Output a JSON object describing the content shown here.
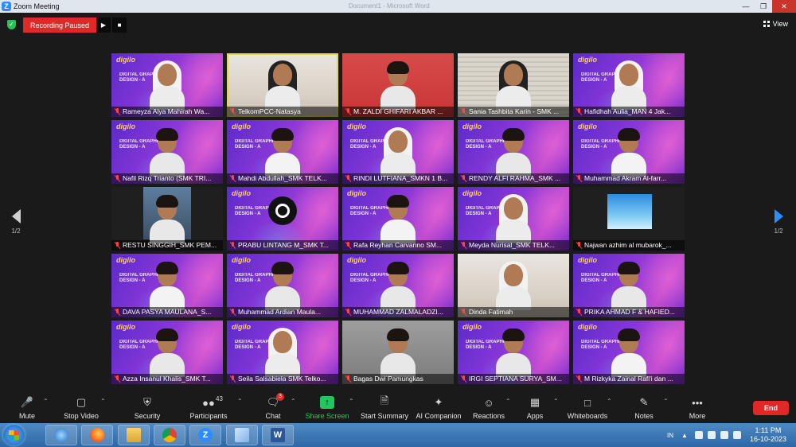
{
  "window": {
    "title": "Zoom Meeting",
    "ghost_title": "Document1 - Microsoft Word"
  },
  "topbar": {
    "recording_label": "Recording Paused",
    "view_label": "View"
  },
  "paging": {
    "left": "1/2",
    "right": "1/2"
  },
  "participants": [
    {
      "name": "Rameyza Alya Mahirah Wa...",
      "bg": "banner"
    },
    {
      "name": "TelkomPCC-Natasya",
      "bg": "room",
      "active": true
    },
    {
      "name": "M. ZALDI GHIFARI AKBAR ...",
      "bg": "red"
    },
    {
      "name": "Sania Tashbita Karin - SMK ...",
      "bg": "blinds"
    },
    {
      "name": "Hafidhah Aulia_MAN 4 Jak...",
      "bg": "banner"
    },
    {
      "name": "Nafil Rizq Trianto (SMK TRI...",
      "bg": "banner"
    },
    {
      "name": "Mahdi Abdullah_SMK TELK...",
      "bg": "banner"
    },
    {
      "name": "RINDI LUTFIANA_SMKN 1 B...",
      "bg": "banner"
    },
    {
      "name": "RENDY ALFI RAHMA_SMK ...",
      "bg": "banner"
    },
    {
      "name": "Muhammad Akram Al-farr...",
      "bg": "banner"
    },
    {
      "name": "RESTU SINGGIH_SMK PEM...",
      "bg": "inset"
    },
    {
      "name": "PRABU LINTANG M_SMK T...",
      "bg": "obs"
    },
    {
      "name": "Rafa Reyhan Carvanno SM...",
      "bg": "banner"
    },
    {
      "name": "Meyda Nurisal_SMK TELK...",
      "bg": "banner"
    },
    {
      "name": "Najwan azhim al mubarok_...",
      "bg": "sky"
    },
    {
      "name": "DAVA PASYA MAULANA_S...",
      "bg": "banner"
    },
    {
      "name": "Muhammad Ardian Maula...",
      "bg": "banner"
    },
    {
      "name": "MUHAMMAD ZALMALADZI...",
      "bg": "banner"
    },
    {
      "name": "Dinda Fatimah",
      "bg": "room"
    },
    {
      "name": "PRIKA AHMAD F & HAFIED...",
      "bg": "banner"
    },
    {
      "name": "Azza Insanul Khalis_SMK T...",
      "bg": "banner"
    },
    {
      "name": "Seila Salsabiela SMK Telko...",
      "bg": "banner"
    },
    {
      "name": "Bagas Dwi Pamungkas",
      "bg": "wall"
    },
    {
      "name": "IRGI SEPTIANA SURYA_SM...",
      "bg": "banner"
    },
    {
      "name": "M Rizkyka Zainal Rafi'i dan ...",
      "bg": "banner"
    }
  ],
  "banner": {
    "logo": "digilo",
    "title_line1": "DIGITAL GRAPHIC",
    "title_line2": "DESIGN - A"
  },
  "toolbar": {
    "mute": "Mute",
    "stop_video": "Stop Video",
    "security": "Security",
    "participants": "Participants",
    "participants_count": "43",
    "chat": "Chat",
    "chat_badge": "3",
    "share_screen": "Share Screen",
    "start_summary": "Start Summary",
    "ai_companion": "AI Companion",
    "reactions": "Reactions",
    "apps": "Apps",
    "whiteboards": "Whiteboards",
    "notes": "Notes",
    "more": "More",
    "end": "End"
  },
  "taskbar": {
    "lang": "IN",
    "time": "1:11 PM",
    "date": "16-10-2023"
  }
}
